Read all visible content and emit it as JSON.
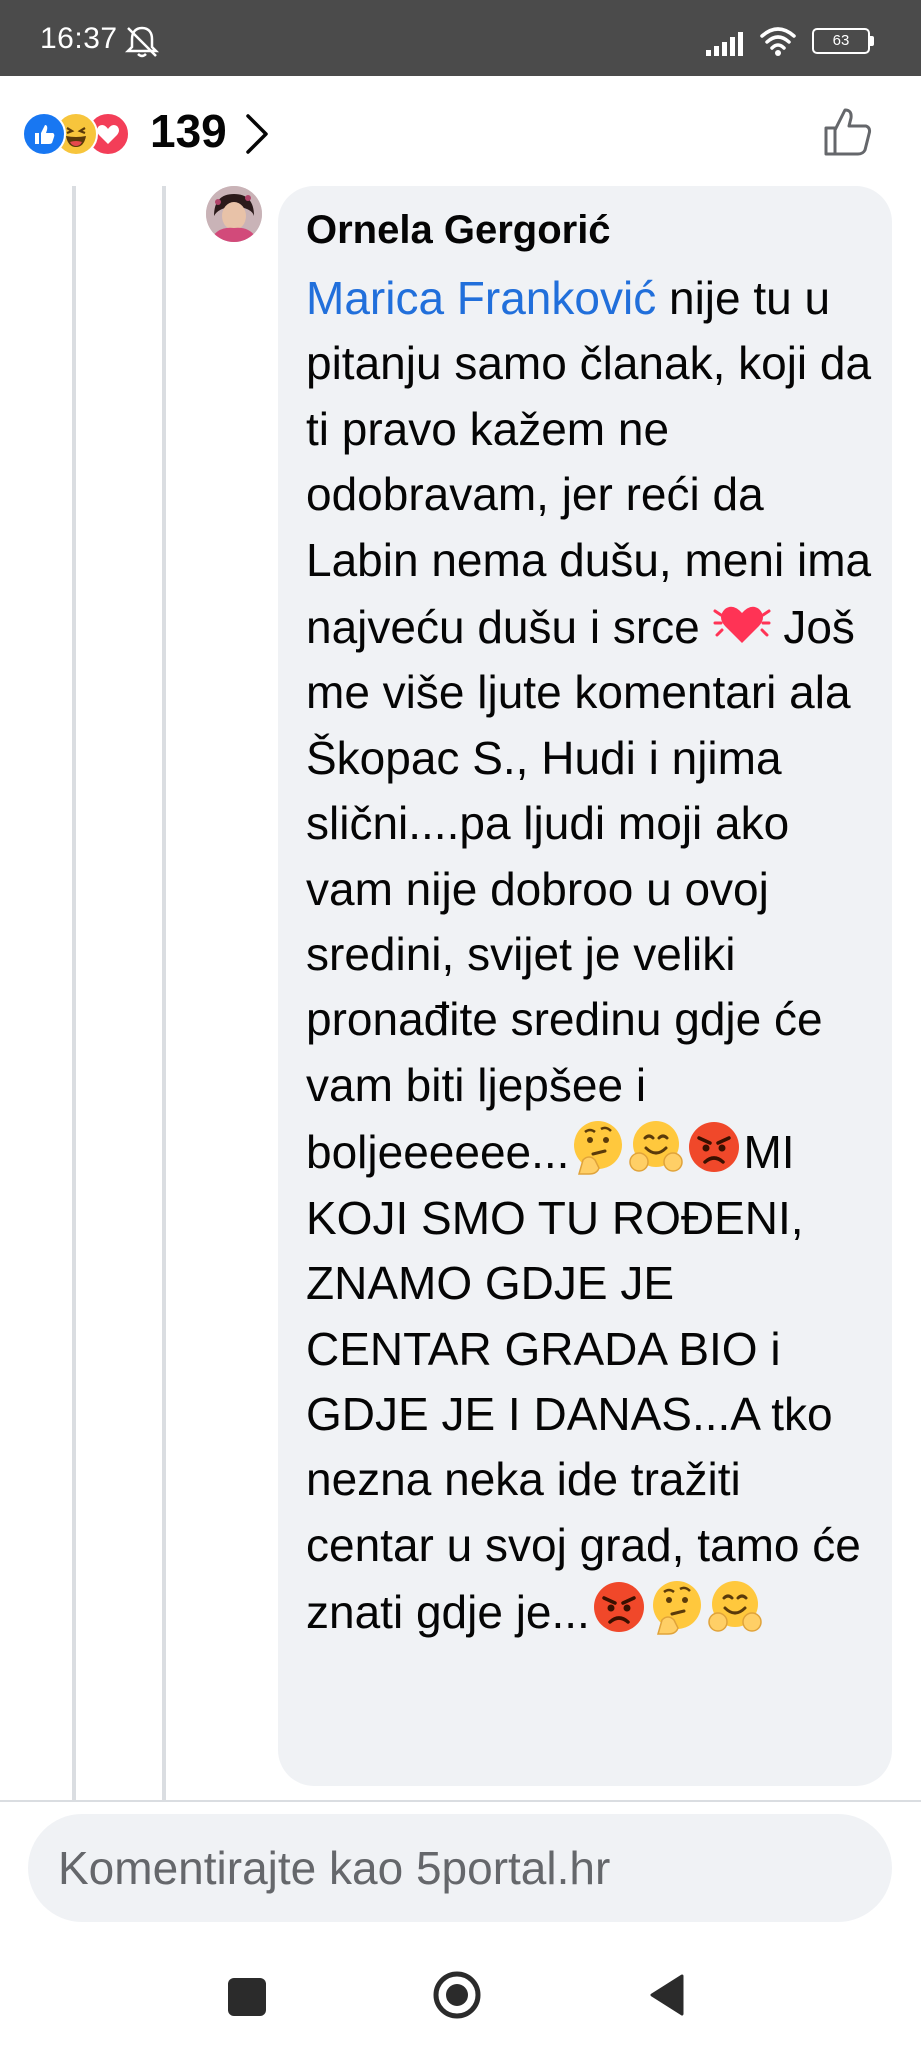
{
  "status_bar": {
    "time": "16:37",
    "battery": "63",
    "icons": [
      "bell-off-icon",
      "signal-icon",
      "wifi-icon",
      "battery-icon"
    ]
  },
  "reaction_bar": {
    "reactions": [
      "like",
      "haha",
      "love"
    ],
    "count": "139",
    "icons": [
      "chevron-right-icon",
      "thumbs-up-icon"
    ]
  },
  "comment": {
    "author": "Ornela Gergorić",
    "mention": "Marica Franković",
    "text_1": " nije tu u pitanju samo članak, koji da ti pravo  kažem ne odobravam, jer reći da Labin nema dušu, meni ima najveću dušu i srce ",
    "text_2": "   Još me više ljute  komentari ala Škopac S., Hudi i njima slični....pa ljudi moji ako vam nije dobroo u ovoj sredini, svijet je veliki pronađite sredinu gdje će vam biti ljepšee i boljeeeeee...",
    "text_3": "MI KOJI SMO TU ROĐENI, ZNAMO GDJE JE CENTAR GRADA BIO i GDJE JE I DANAS...A tko nezna neka ide tražiti centar u svoj grad, tamo će znati gdje je...",
    "emojis": [
      "beating-heart",
      "thinking-face",
      "hugging-face",
      "angry-face",
      "angry-face",
      "thinking-face",
      "hugging-face"
    ]
  },
  "composer": {
    "placeholder": "Komentirajte kao 5portal.hr"
  },
  "colors": {
    "status_bar": "#4b4b4b",
    "bubble": "#f0f2f5",
    "mention": "#216fdb",
    "like": "#1877f2",
    "haha": "#f7c53c",
    "love": "#f33e58"
  }
}
